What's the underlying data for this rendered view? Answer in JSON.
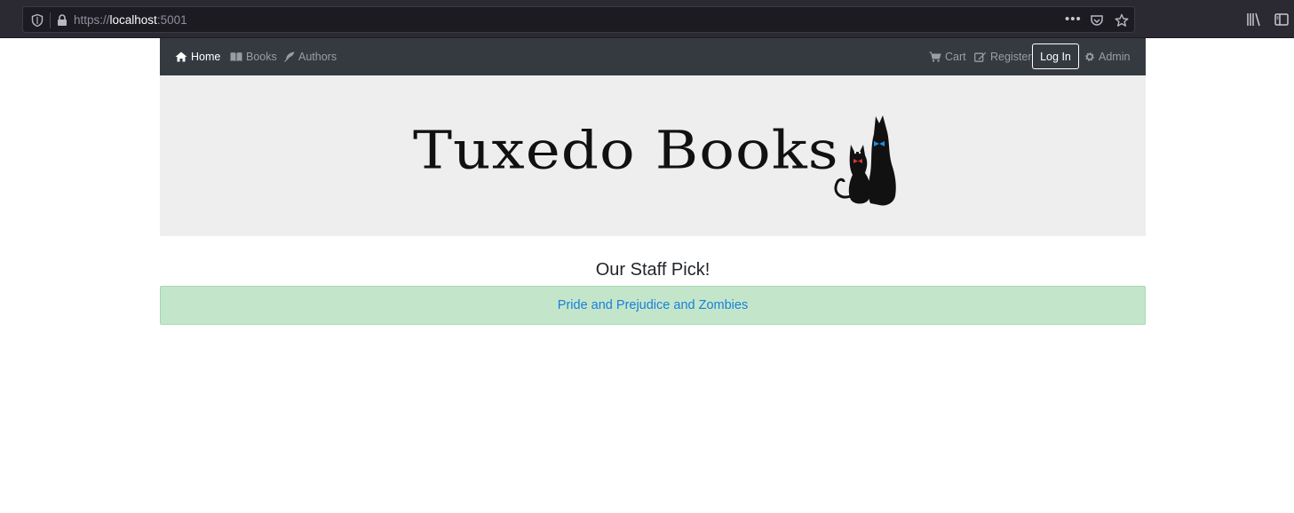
{
  "browser": {
    "url_scheme": "https://",
    "url_host": "localhost",
    "url_port": ":5001"
  },
  "nav": {
    "home": "Home",
    "books": "Books",
    "authors": "Authors",
    "cart": "Cart",
    "register": "Register",
    "login": "Log In",
    "admin": "Admin"
  },
  "banner": {
    "brand": "Tuxedo Books"
  },
  "main": {
    "staff_pick_heading": "Our Staff Pick!",
    "staff_pick_book": "Pride and Prejudice and Zombies"
  },
  "colors": {
    "navbar": "#343a40",
    "banner_bg": "#eeeeee",
    "pick_bg": "#c3e6cb",
    "link": "#1a7fd9"
  },
  "icons": {
    "home": "home-icon",
    "books": "book-icon",
    "authors": "feather-icon",
    "cart": "cart-icon",
    "register": "edit-icon",
    "admin": "gear-icon"
  }
}
